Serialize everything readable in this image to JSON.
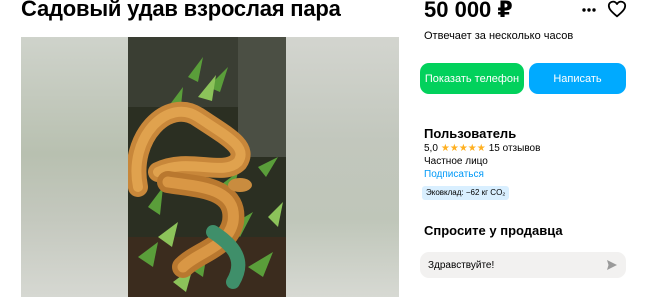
{
  "listing": {
    "title": "Садовый удав взрослая пара",
    "price": "50 000 ₽",
    "reply_time": "Отвечает за несколько часов"
  },
  "actions": {
    "show_phone": "Показать телефон",
    "write": "Написать"
  },
  "icons": {
    "more": "more-dots-icon",
    "favorite": "heart-icon",
    "send": "send-icon",
    "star": "star-icon"
  },
  "seller": {
    "name": "Пользователь",
    "rating": "5,0",
    "stars": "★★★★★",
    "reviews": "15 отзывов",
    "type": "Частное лицо",
    "subscribe": "Подписаться",
    "eco_badge": "Эковклад: −62 кг CO₂"
  },
  "ask": {
    "title": "Спросите у продавца",
    "message": "Здравствуйте!"
  },
  "colors": {
    "phone_button": "#02d15c",
    "write_button": "#00aaff",
    "link": "#0099f7",
    "star": "#ffb021",
    "eco_badge_bg": "#d9efff"
  }
}
